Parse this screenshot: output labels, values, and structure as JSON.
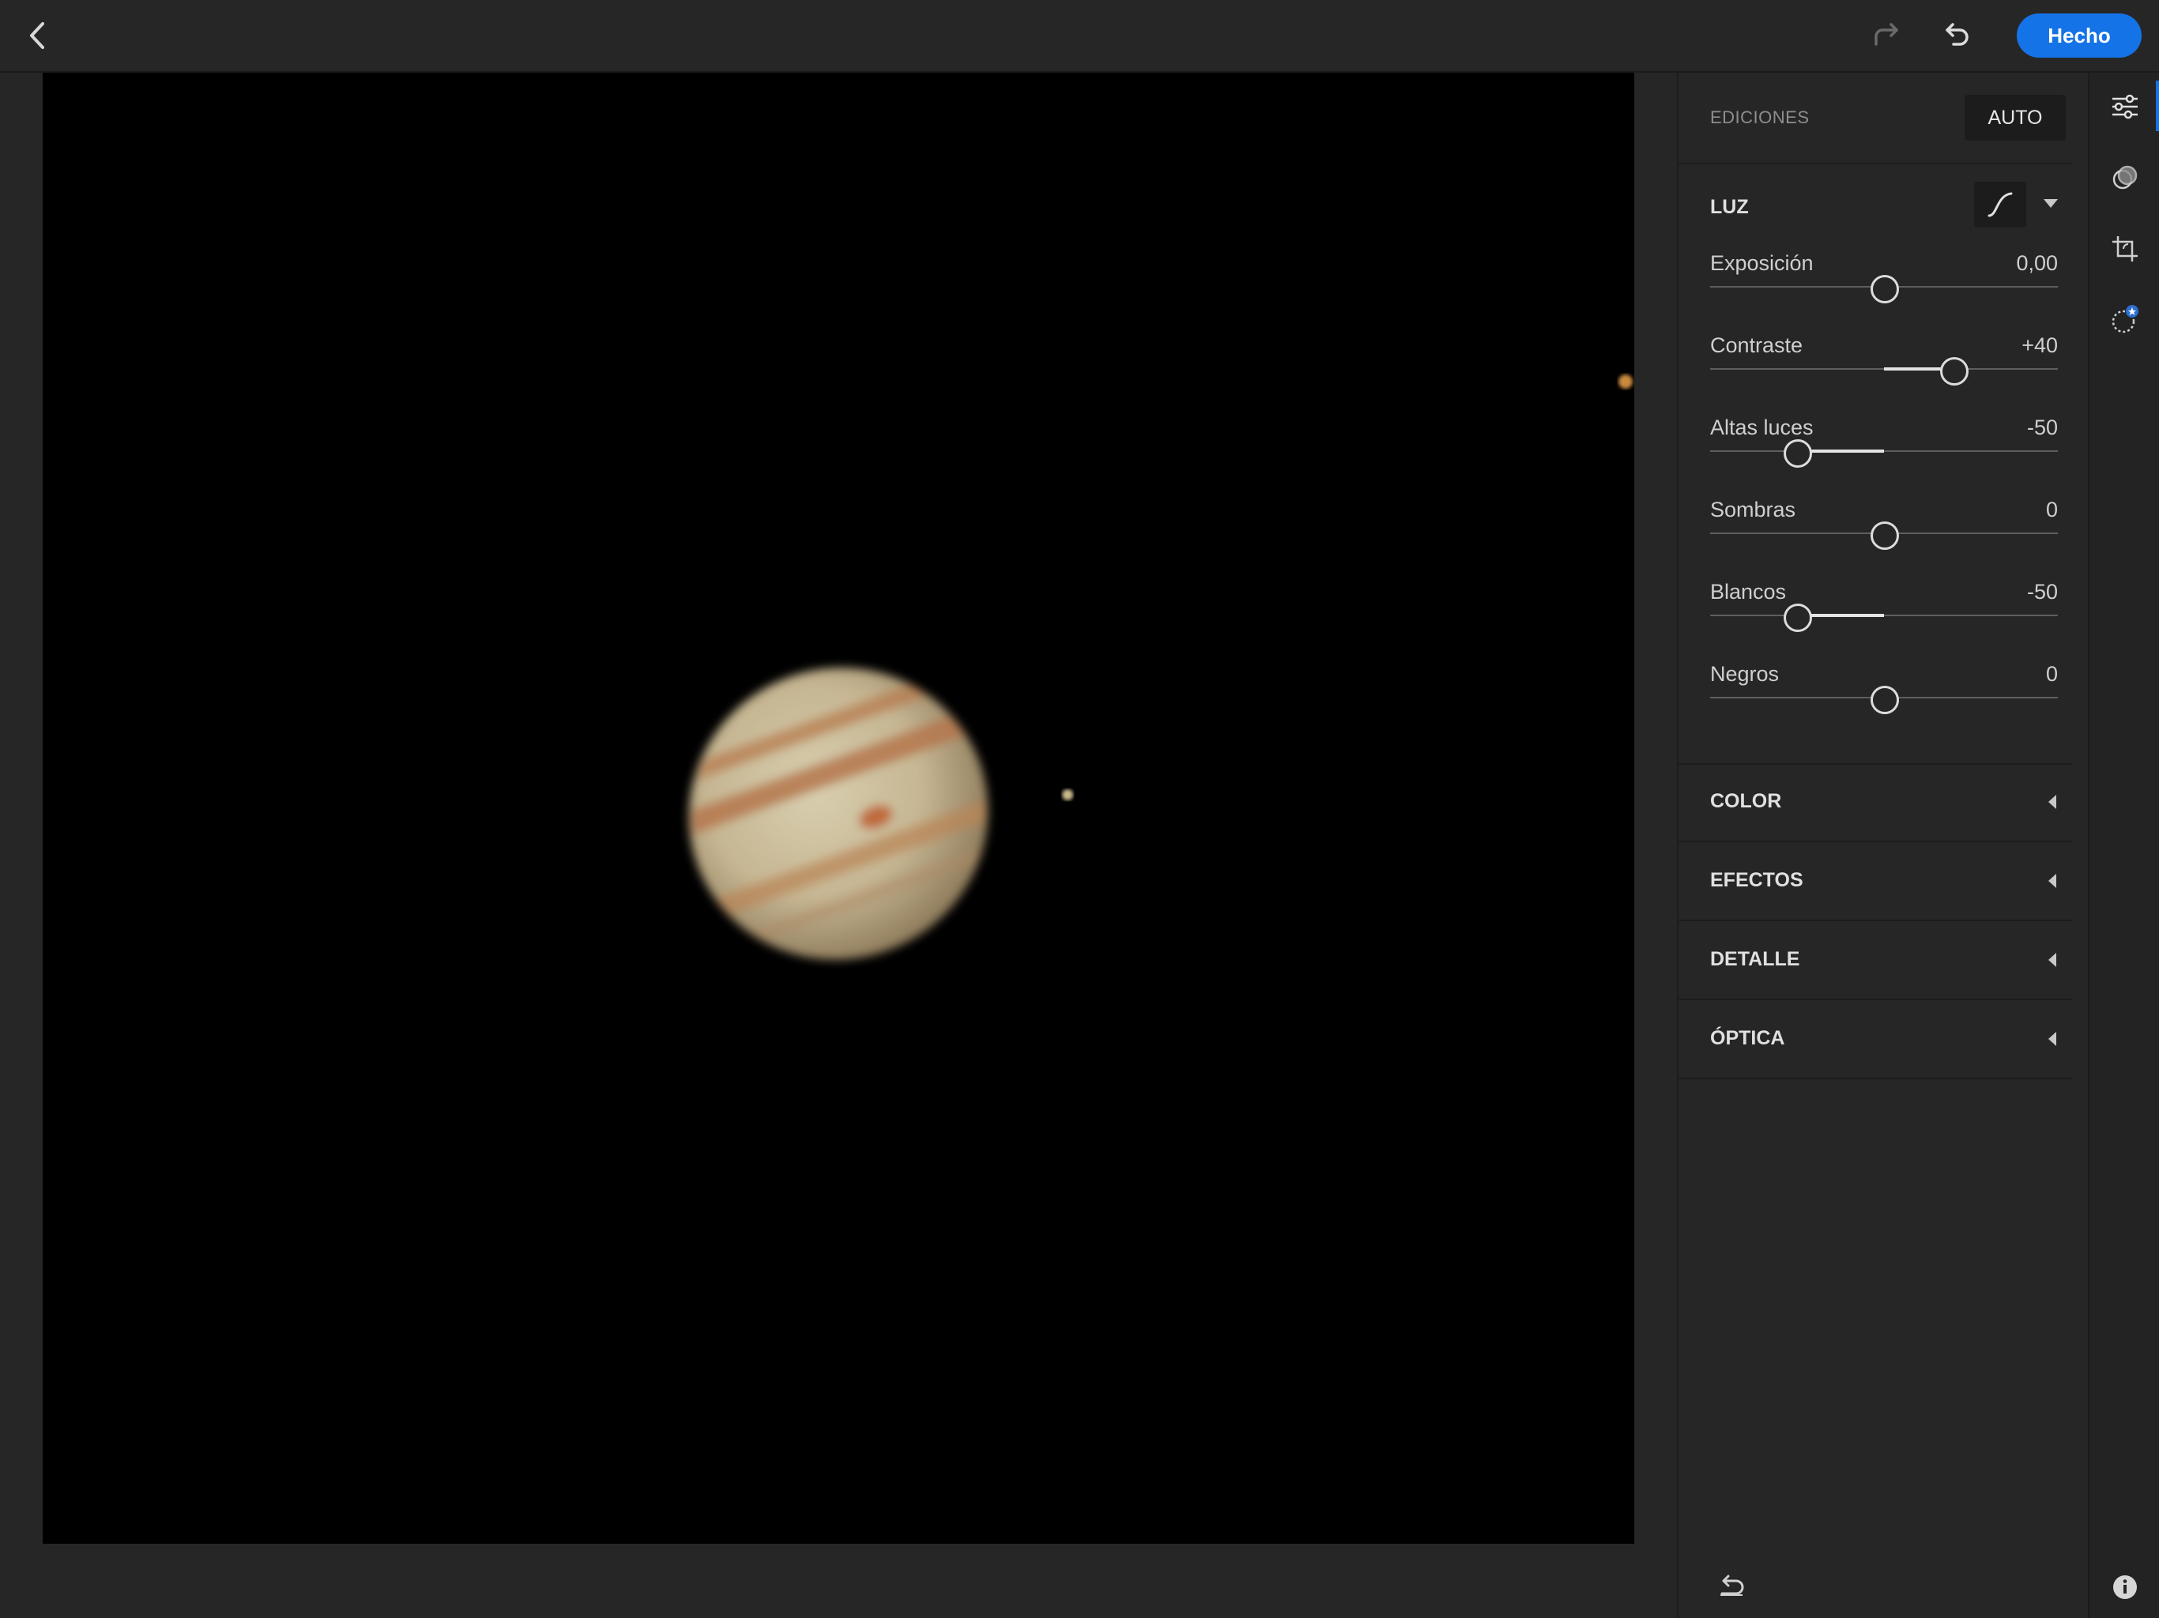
{
  "topbar": {
    "back_icon": "chevron-left-icon",
    "redo_icon": "redo-icon",
    "undo_icon": "undo-icon",
    "done_label": "Hecho",
    "accent_color": "#1473e6"
  },
  "photo": {
    "subject": "jupiter-photo",
    "background": "#000000"
  },
  "panel": {
    "title": "EDICIONES",
    "auto_label": "AUTO",
    "light": {
      "title": "LUZ",
      "curve_icon": "tone-curve-icon",
      "sliders": [
        {
          "label": "Exposición",
          "value": "0,00",
          "level": 0.5
        },
        {
          "label": "Contraste",
          "value": "+40",
          "level": 0.7
        },
        {
          "label": "Altas luces",
          "value": "-50",
          "level": 0.25
        },
        {
          "label": "Sombras",
          "value": "0",
          "level": 0.5
        },
        {
          "label": "Blancos",
          "value": "-50",
          "level": 0.25
        },
        {
          "label": "Negros",
          "value": "0",
          "level": 0.5
        }
      ]
    },
    "sections": [
      {
        "title": "COLOR"
      },
      {
        "title": "EFECTOS"
      },
      {
        "title": "DETALLE"
      },
      {
        "title": "ÓPTICA"
      }
    ],
    "reset_icon": "reset-icon"
  },
  "rail": {
    "tools": [
      "edit-sliders-icon",
      "presets-icon",
      "crop-icon",
      "selective-icon"
    ],
    "info_icon": "info-icon"
  }
}
